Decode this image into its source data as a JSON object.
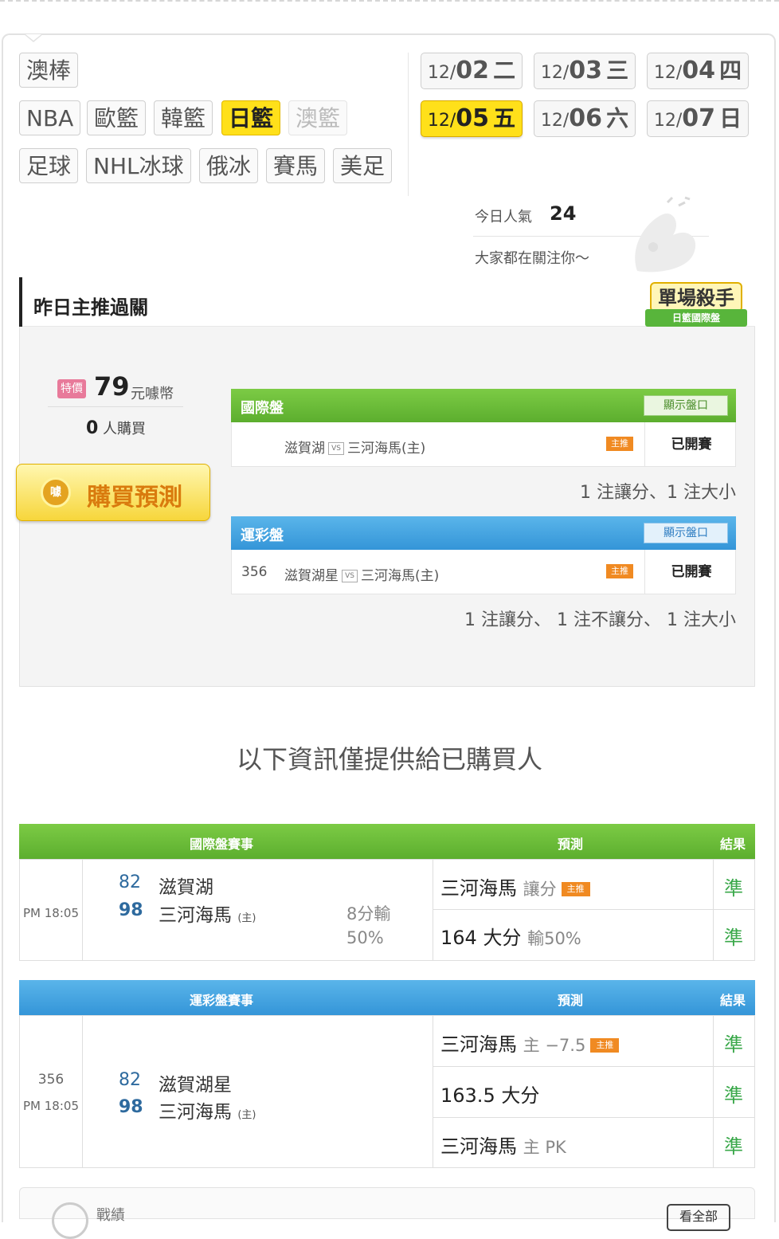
{
  "sports_row1": [
    "澳棒"
  ],
  "sports_row2": [
    "NBA",
    "歐籃",
    "韓籃",
    "日籃",
    "澳籃"
  ],
  "sports_row3": [
    "足球",
    "NHL冰球",
    "俄冰",
    "賽馬",
    "美足"
  ],
  "active_sport": "日籃",
  "disabled_sport": "澳籃",
  "dates": [
    {
      "md": "12/",
      "dd": "02",
      "wk": "二"
    },
    {
      "md": "12/",
      "dd": "03",
      "wk": "三"
    },
    {
      "md": "12/",
      "dd": "04",
      "wk": "四"
    },
    {
      "md": "12/",
      "dd": "05",
      "wk": "五"
    },
    {
      "md": "12/",
      "dd": "06",
      "wk": "六"
    },
    {
      "md": "12/",
      "dd": "07",
      "wk": "日"
    }
  ],
  "active_date": "05",
  "popularity": {
    "label": "今日人氣",
    "value": "24",
    "sub": "大家都在關注你～"
  },
  "section": {
    "title": "昨日主推過關",
    "badge_main": "單場殺手",
    "badge_sub": "日籃國際盤"
  },
  "pricing": {
    "tag": "特價",
    "price": "79",
    "unit": "元噱幣",
    "buyers_count": "0",
    "buyers_label": "人購買",
    "buy_button": "購買預測",
    "coin_glyph": "噱"
  },
  "markets": [
    {
      "title": "國際盤",
      "show_label": "顯示盤口",
      "code": "",
      "home": "滋賀湖",
      "vs": "VS",
      "away": "三河海馬(主)",
      "main_tag": "主推",
      "status": "已開賽",
      "note": "1 注讓分、1 注大小"
    },
    {
      "title": "運彩盤",
      "show_label": "顯示盤口",
      "code": "356",
      "home": "滋賀湖星",
      "vs": "VS",
      "away": "三河海馬(主)",
      "main_tag": "主推",
      "status": "已開賽",
      "note": "1 注讓分、 1 注不讓分、 1 注大小"
    }
  ],
  "info_title": "以下資訊僅提供給已購買人",
  "table_intl": {
    "headers": [
      "國際盤賽事",
      "預測",
      "結果"
    ],
    "time": "PM 18:05",
    "team1": {
      "score": "82",
      "name": "滋賀湖"
    },
    "team2": {
      "score": "98",
      "name": "三河海馬",
      "host": "(主)"
    },
    "spread": "8分輸",
    "spread_pct": "50%",
    "predictions": [
      {
        "main": "三河海馬",
        "grey": "讓分",
        "tag": "主推",
        "result": "準"
      },
      {
        "main": "164 大分",
        "grey": "輸50%",
        "tag": "",
        "result": "準"
      }
    ]
  },
  "table_sports": {
    "headers": [
      "運彩盤賽事",
      "預測",
      "結果"
    ],
    "code": "356",
    "time": "PM 18:05",
    "team1": {
      "score": "82",
      "name": "滋賀湖星"
    },
    "team2": {
      "score": "98",
      "name": "三河海馬",
      "host": "(主)"
    },
    "predictions": [
      {
        "main": "三河海馬",
        "grey": "主 −7.5",
        "tag": "主推",
        "result": "準"
      },
      {
        "main": "163.5 大分",
        "grey": "",
        "tag": "",
        "result": "準"
      },
      {
        "main": "三河海馬",
        "grey": "主 PK",
        "tag": "",
        "result": "準"
      }
    ]
  },
  "footer": {
    "label": "戰績",
    "button": "看全部"
  }
}
